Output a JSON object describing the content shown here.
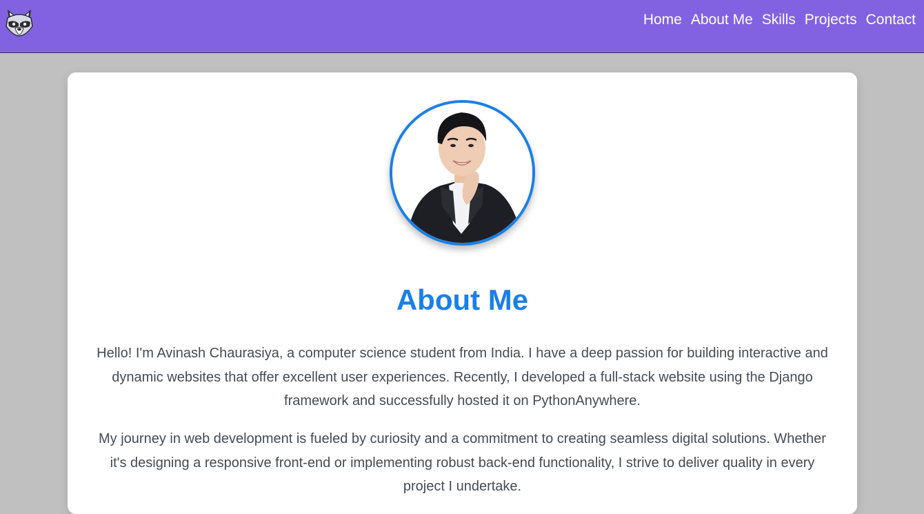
{
  "nav": {
    "logo_icon": "raccoon-logo-icon",
    "links": [
      "Home",
      "About Me",
      "Skills",
      "Projects",
      "Contact"
    ]
  },
  "about": {
    "heading": "About Me",
    "paragraphs": [
      "Hello! I'm Avinash Chaurasiya, a computer science student from India. I have a deep passion for building interactive and dynamic websites that offer excellent user experiences. Recently, I developed a full-stack website using the Django framework and successfully hosted it on PythonAnywhere.",
      "My journey in web development is fueled by curiosity and a commitment to creating seamless digital solutions. Whether it's designing a responsive front-end or implementing robust back-end functionality, I strive to deliver quality in every project I undertake."
    ]
  },
  "colors": {
    "navbar": "#8262e0",
    "accent": "#1a7fe8",
    "page_background": "#c0c0c0",
    "text": "#444b52"
  }
}
